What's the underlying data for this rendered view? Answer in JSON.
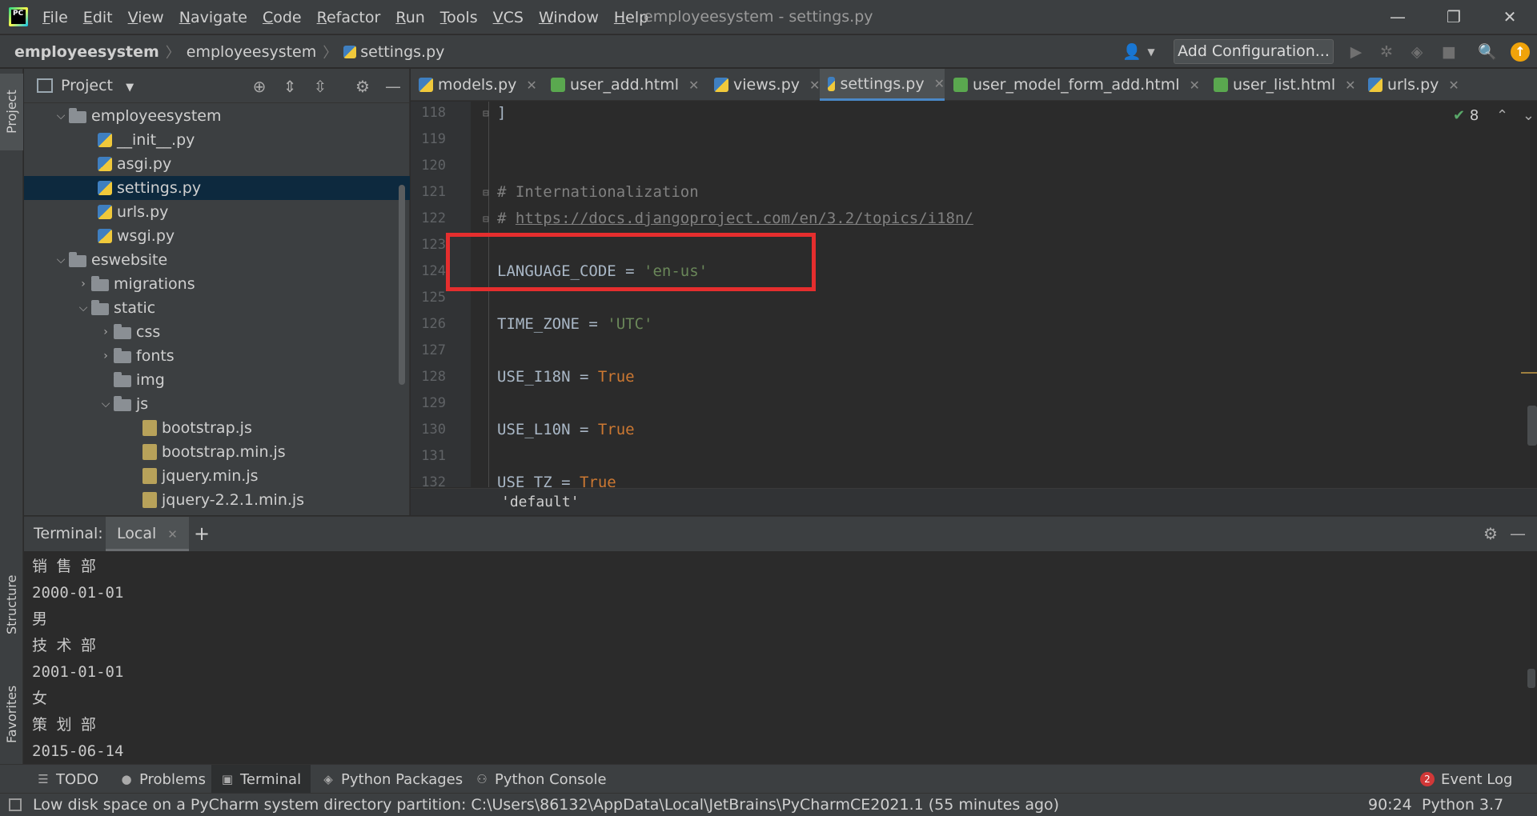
{
  "window": {
    "title": "employeesystem - settings.py",
    "logo_text": "PC",
    "minimize": "—",
    "restore": "❐",
    "close": "✕"
  },
  "menu": [
    "File",
    "Edit",
    "View",
    "Navigate",
    "Code",
    "Refactor",
    "Run",
    "Tools",
    "VCS",
    "Window",
    "Help"
  ],
  "breadcrumb": [
    "employeesystem",
    "employeesystem",
    "settings.py"
  ],
  "toolbar": {
    "add_configuration": "Add Configuration..."
  },
  "sidebar_tabs": {
    "project": "Project",
    "structure": "Structure",
    "favorites": "Favorites"
  },
  "project_panel": {
    "title": "Project",
    "tree": [
      {
        "label": "employeesystem",
        "type": "folder",
        "expanded": true
      },
      {
        "label": "__init__.py",
        "type": "py"
      },
      {
        "label": "asgi.py",
        "type": "py"
      },
      {
        "label": "settings.py",
        "type": "py",
        "selected": true
      },
      {
        "label": "urls.py",
        "type": "py"
      },
      {
        "label": "wsgi.py",
        "type": "py"
      },
      {
        "label": "eswebsite",
        "type": "folder",
        "expanded": true
      },
      {
        "label": "migrations",
        "type": "folder",
        "expanded": false
      },
      {
        "label": "static",
        "type": "folder",
        "expanded": true
      },
      {
        "label": "css",
        "type": "folder",
        "expanded": false
      },
      {
        "label": "fonts",
        "type": "folder",
        "expanded": false
      },
      {
        "label": "img",
        "type": "folder"
      },
      {
        "label": "js",
        "type": "folder",
        "expanded": true
      },
      {
        "label": "bootstrap.js",
        "type": "js"
      },
      {
        "label": "bootstrap.min.js",
        "type": "js"
      },
      {
        "label": "jquery.min.js",
        "type": "js"
      },
      {
        "label": "jquery-2.2.1.min.js",
        "type": "js"
      }
    ]
  },
  "editor": {
    "tabs": [
      {
        "label": "models.py",
        "icon": "python-file-icon"
      },
      {
        "label": "user_add.html",
        "icon": "html-file-icon"
      },
      {
        "label": "views.py",
        "icon": "python-file-icon"
      },
      {
        "label": "settings.py",
        "icon": "python-file-icon",
        "active": true
      },
      {
        "label": "user_model_form_add.html",
        "icon": "html-file-icon"
      },
      {
        "label": "user_list.html",
        "icon": "html-file-icon"
      },
      {
        "label": "urls.py",
        "icon": "python-file-icon"
      }
    ],
    "inspection_count": "8",
    "lines": [
      {
        "num": "118",
        "code": "]"
      },
      {
        "num": "119",
        "code": ""
      },
      {
        "num": "120",
        "code": ""
      },
      {
        "num": "121",
        "code": "# Internationalization"
      },
      {
        "num": "122",
        "code": "# https://docs.djangoproject.com/en/3.2/topics/i18n/"
      },
      {
        "num": "123",
        "code": ""
      },
      {
        "num": "124",
        "code": "LANGUAGE_CODE = 'en-us'"
      },
      {
        "num": "125",
        "code": ""
      },
      {
        "num": "126",
        "code": "TIME_ZONE = 'UTC'"
      },
      {
        "num": "127",
        "code": ""
      },
      {
        "num": "128",
        "code": "USE_I18N = True"
      },
      {
        "num": "129",
        "code": ""
      },
      {
        "num": "130",
        "code": "USE_L10N = True"
      },
      {
        "num": "131",
        "code": ""
      },
      {
        "num": "132",
        "code": "USE_TZ = True"
      }
    ],
    "code_parts": {
      "comment_prefix": "# ",
      "comment1": "# Internationalization",
      "link": "https://docs.djangoproject.com/en/3.2/topics/i18n/",
      "language_code_var": "LANGUAGE_CODE = ",
      "language_code_val": "'en-us'",
      "time_zone_var": "TIME_ZONE = ",
      "time_zone_val": "'UTC'",
      "use_i18n_var": "USE_I18N = ",
      "use_l10n_var": "USE_L10N = ",
      "use_tz_var": "USE_TZ = ",
      "true_kw": "True",
      "bracket": "]"
    },
    "breadcrumb_bar": "'default'"
  },
  "terminal": {
    "title": "Terminal:",
    "tab_local": "Local",
    "lines": [
      "销 售 部",
      "2000-01-01",
      "男",
      "技 术 部",
      "2001-01-01",
      "女",
      "策 划 部",
      "2015-06-14"
    ]
  },
  "bottom_tabs": [
    "TODO",
    "Problems",
    "Terminal",
    "Python Packages",
    "Python Console"
  ],
  "event_log": {
    "label": "Event Log",
    "count": "2"
  },
  "status": {
    "message": "Low disk space on a PyCharm system directory partition: C:\\Users\\86132\\AppData\\Local\\JetBrains\\PyCharmCE2021.1 (55 minutes ago)",
    "position": "90:24",
    "interpreter": "Python 3.7"
  }
}
